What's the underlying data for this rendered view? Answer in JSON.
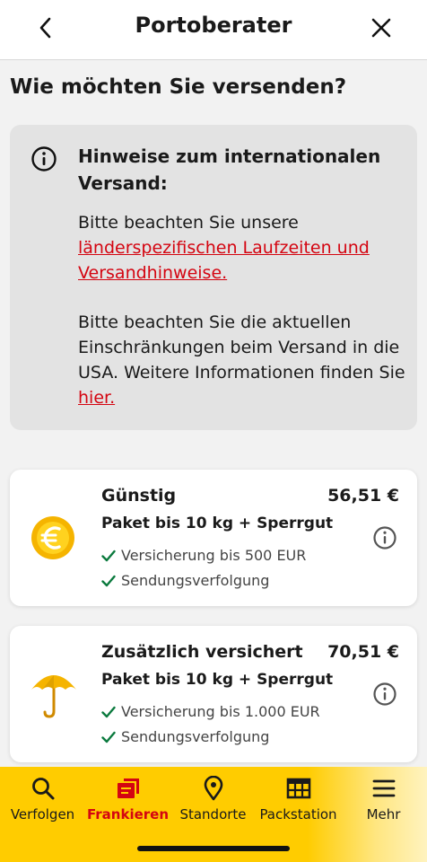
{
  "header": {
    "title": "Portoberater"
  },
  "page_title": "Wie möchten Sie versenden?",
  "notice": {
    "title": "Hinweise zum internationalen Versand:",
    "para1_text": "Bitte beachten Sie unsere",
    "para1_link": "länderspezifischen Laufzeiten und Versandhinweise.",
    "para2_text": "Bitte beachten Sie die aktuellen Einschränkungen beim Versand in die USA. Weitere Informationen finden Sie",
    "para2_link": "hier."
  },
  "options": [
    {
      "name": "Günstig",
      "price": "56,51 €",
      "subtitle": "Paket bis 10 kg + Sperrgut",
      "features": [
        "Versicherung bis 500 EUR",
        "Sendungsverfolgung"
      ],
      "icon": "euro-coin-icon"
    },
    {
      "name": "Zusätzlich versichert",
      "price": "70,51 €",
      "subtitle": "Paket bis 10 kg + Sperrgut",
      "features": [
        "Versicherung bis 1.000 EUR",
        "Sendungsverfolgung"
      ],
      "icon": "umbrella-icon"
    }
  ],
  "tabs": [
    {
      "label": "Verfolgen",
      "icon": "search-icon"
    },
    {
      "label": "Frankieren",
      "icon": "stamp-icon",
      "active": true
    },
    {
      "label": "Standorte",
      "icon": "location-pin-icon"
    },
    {
      "label": "Packstation",
      "icon": "packstation-icon"
    },
    {
      "label": "Mehr",
      "icon": "menu-icon"
    }
  ],
  "colors": {
    "brand_yellow": "#ffcc00",
    "brand_red": "#d40511",
    "check_green": "#0b7a3e",
    "coin_gold": "#f5b400"
  }
}
